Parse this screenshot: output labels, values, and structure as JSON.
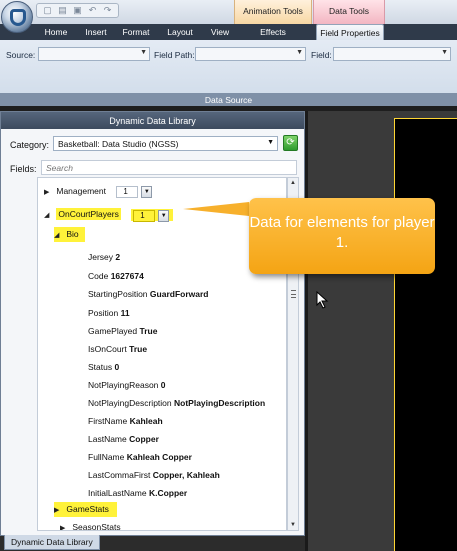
{
  "ribbon": {
    "context_tabs": {
      "animation_tools": "Animation Tools",
      "data_tools": "Data Tools"
    },
    "tabs": {
      "home": "Home",
      "insert": "Insert",
      "format": "Format",
      "layout": "Layout",
      "view": "View",
      "effects": "Effects",
      "field_properties": "Field Properties"
    },
    "active_tab": "Field Properties",
    "source_label": "Source:",
    "field_path_label": "Field Path:",
    "field_label": "Field:",
    "group_label": "Data Source"
  },
  "panel": {
    "title": "Dynamic Data Library",
    "category_label": "Category:",
    "category_value": "Basketball: Data Studio (NGSS)",
    "fields_label": "Fields:",
    "search_placeholder": "Search",
    "bottom_tab": "Dynamic Data Library"
  },
  "tree": {
    "management": {
      "label": "Management",
      "value": "1"
    },
    "on_court_players": {
      "label": "OnCourtPlayers",
      "value": "1"
    },
    "bio": {
      "label": "Bio"
    },
    "fields": [
      {
        "name": "Jersey",
        "value": "2"
      },
      {
        "name": "Code",
        "value": "1627674"
      },
      {
        "name": "StartingPosition",
        "value": "GuardForward"
      },
      {
        "name": "Position",
        "value": "11"
      },
      {
        "name": "GamePlayed",
        "value": "True"
      },
      {
        "name": "IsOnCourt",
        "value": "True"
      },
      {
        "name": "Status",
        "value": "0"
      },
      {
        "name": "NotPlayingReason",
        "value": "0"
      },
      {
        "name": "NotPlayingDescription",
        "value": "NotPlayingDescription"
      },
      {
        "name": "FirstName",
        "value": "Kahleah"
      },
      {
        "name": "LastName",
        "value": "Copper"
      },
      {
        "name": "FullName",
        "value": "Kahleah Copper"
      },
      {
        "name": "LastCommaFirst",
        "value": "Copper, Kahleah"
      },
      {
        "name": "InitialLastName",
        "value": "K.Copper"
      }
    ],
    "game_stats": {
      "label": "GameStats"
    },
    "season_stats": {
      "label": "SeasonStats"
    }
  },
  "callout": {
    "text": "Data for elements for player 1."
  },
  "colors": {
    "highlight": "#fff23a",
    "callout": "#f4a414",
    "canvas_border": "#ffd633"
  }
}
